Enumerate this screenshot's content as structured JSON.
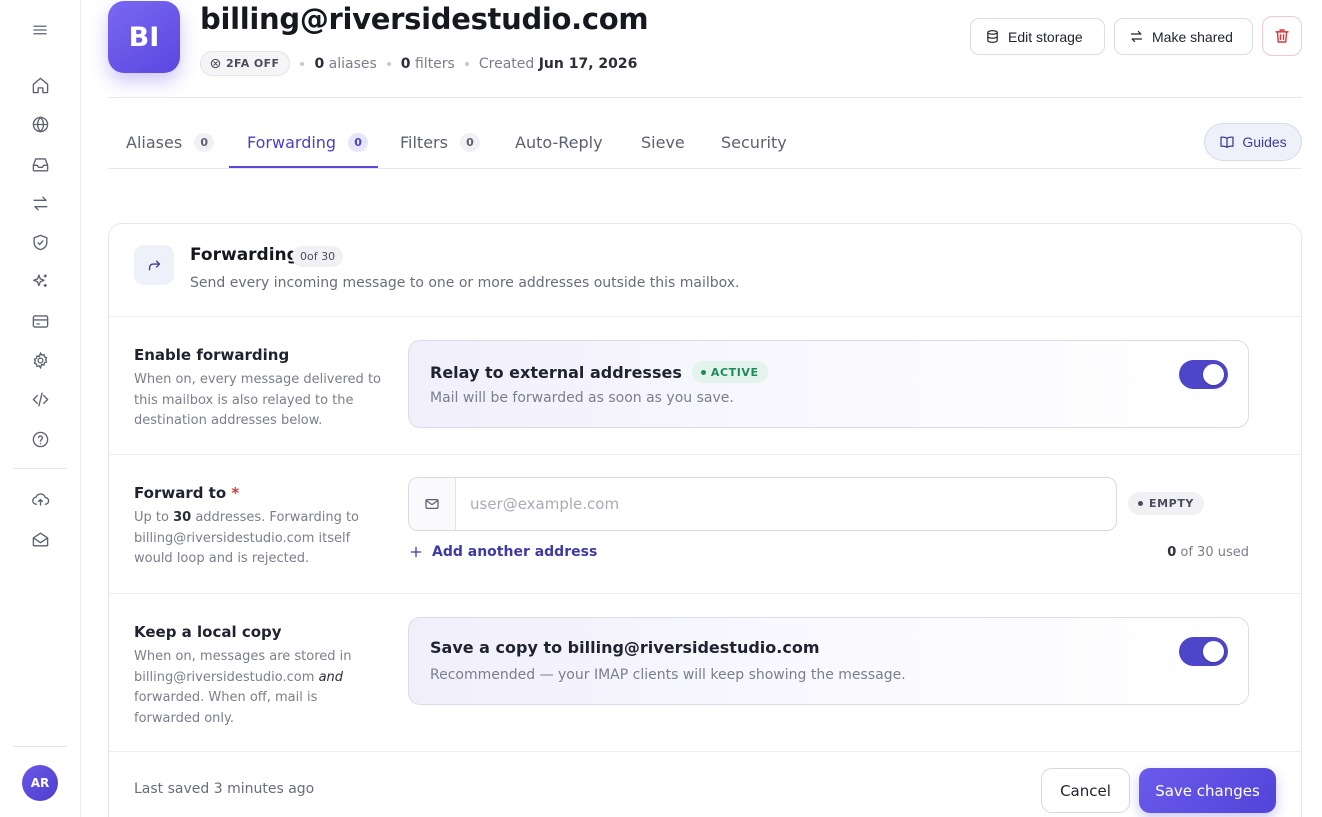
{
  "sidebar": {
    "items": [
      {
        "icon": "menu-icon"
      },
      {
        "icon": "home-icon"
      },
      {
        "icon": "globe-icon"
      },
      {
        "icon": "inbox-icon"
      },
      {
        "icon": "arrows-swap-icon"
      },
      {
        "icon": "shield-check-icon"
      },
      {
        "icon": "sparkles-icon"
      },
      {
        "icon": "credit-card-icon"
      },
      {
        "icon": "gear-icon"
      },
      {
        "icon": "code-icon"
      },
      {
        "icon": "help-circle-icon"
      },
      {
        "icon": "cloud-upload-icon"
      },
      {
        "icon": "mail-open-icon"
      }
    ],
    "user_initials": "AR"
  },
  "header": {
    "avatar_initials": "BI",
    "title": "billing@riversidestudio.com",
    "tfa_badge": "2FA OFF",
    "aliases_count": "0",
    "aliases_label": "aliases",
    "filters_count": "0",
    "filters_label": "filters",
    "created_label": "Created",
    "created_date": "Jun 17, 2026",
    "edit_storage_label": "Edit storage",
    "make_shared_label": "Make shared"
  },
  "tabs": [
    {
      "label": "Aliases",
      "count": "0"
    },
    {
      "label": "Forwarding",
      "count": "0"
    },
    {
      "label": "Filters",
      "count": "0"
    },
    {
      "label": "Auto-Reply"
    },
    {
      "label": "Sieve"
    },
    {
      "label": "Security"
    }
  ],
  "guides_label": "Guides",
  "section": {
    "title": "Forwarding",
    "count_badge": "0of 30",
    "description": "Send every incoming message to one or more addresses outside this mailbox."
  },
  "enable_forwarding": {
    "label": "Enable forwarding",
    "description": "When on, every message delivered to this mailbox is also relayed to the destination addresses below.",
    "box_title": "Relay to external addresses",
    "status": "ACTIVE",
    "box_subtitle": "Mail will be forwarded as soon as you save.",
    "enabled": true
  },
  "forward_to": {
    "label": "Forward to",
    "required_mark": "*",
    "desc_prefix": "Up to",
    "desc_limit": "30",
    "desc_suffix": "addresses. Forwarding to billing@riversidestudio.com itself would loop and is rejected.",
    "input_value": "",
    "placeholder": "user@example.com",
    "status": "EMPTY",
    "add_label": "Add another address",
    "used_count": "0",
    "used_suffix": "of 30 used"
  },
  "local_copy": {
    "label": "Keep a local copy",
    "desc_prefix": "When on, messages are stored in billing@riversidestudio.com",
    "desc_em": "and",
    "desc_suffix": "forwarded. When off, mail is forwarded only.",
    "box_title": "Save a copy to billing@riversidestudio.com",
    "box_subtitle": "Recommended — your IMAP clients will keep showing the message.",
    "enabled": true
  },
  "footer": {
    "last_saved": "Last saved 3 minutes ago",
    "cancel_label": "Cancel",
    "save_label": "Save changes"
  },
  "colors": {
    "accent": "#5a47e0",
    "toggle_on": "#4e46c9",
    "success": "#1f8a5c",
    "danger": "#d93838"
  }
}
